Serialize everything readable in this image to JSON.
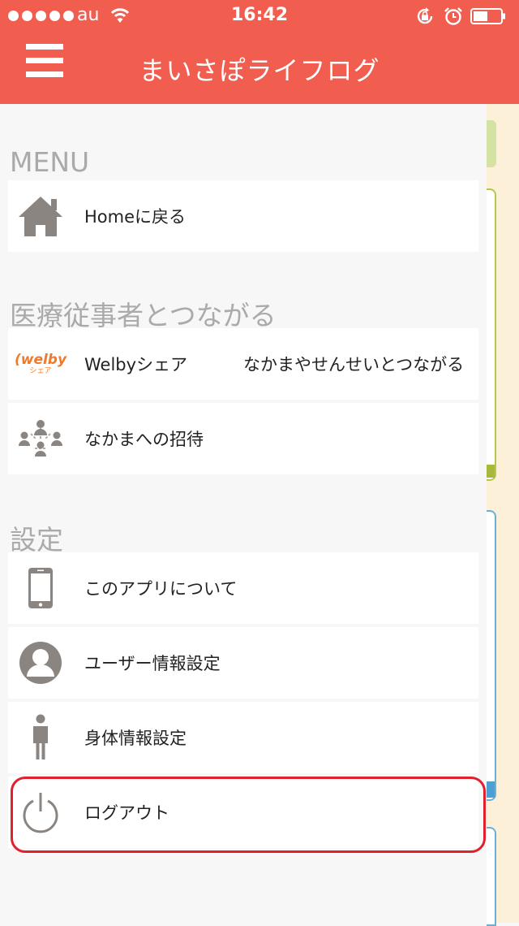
{
  "status_bar": {
    "carrier": "au",
    "time": "16:42"
  },
  "header": {
    "title": "まいさぽライフログ"
  },
  "colors": {
    "header_bg": "#f15e50",
    "highlight": "#e0202c",
    "section_title": "#aaaaaa"
  },
  "sections": {
    "menu": {
      "title": "MENU",
      "items": [
        {
          "label": "Homeに戻る",
          "icon": "home-icon"
        }
      ]
    },
    "medical": {
      "title": "医療従事者とつながる",
      "items": [
        {
          "label": "Welbyシェア",
          "label2": "なかまやせんせいとつながる",
          "icon": "welby-logo",
          "logo_text": "welby",
          "logo_sub": "シェア"
        },
        {
          "label": "なかまへの招待",
          "icon": "group-icon"
        }
      ]
    },
    "settings": {
      "title": "設定",
      "items": [
        {
          "label": "このアプリについて",
          "icon": "phone-icon"
        },
        {
          "label": "ユーザー情報設定",
          "icon": "user-icon"
        },
        {
          "label": "身体情報設定",
          "icon": "body-icon"
        },
        {
          "label": "ログアウト",
          "icon": "power-icon"
        }
      ]
    }
  }
}
